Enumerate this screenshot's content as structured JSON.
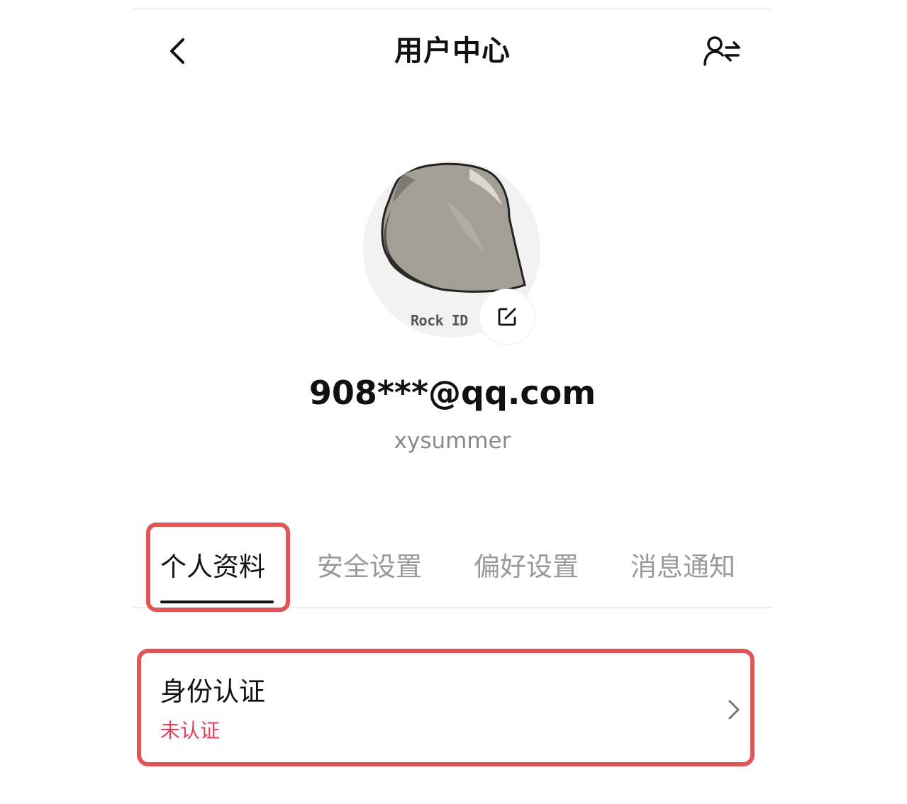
{
  "header": {
    "back_icon": "chevron-left-icon",
    "title": "用户中心",
    "switch_icon": "user-switch-icon"
  },
  "profile": {
    "avatar_caption": "Rock ID",
    "edit_icon": "edit-icon",
    "email": "908***@qq.com",
    "nickname": "xysummer"
  },
  "tabs": [
    {
      "label": "个人资料",
      "active": true
    },
    {
      "label": "安全设置",
      "active": false
    },
    {
      "label": "偏好设置",
      "active": false
    },
    {
      "label": "消息通知",
      "active": false
    }
  ],
  "identity": {
    "title": "身份认证",
    "status": "未认证",
    "chevron_icon": "chevron-right-icon"
  },
  "colors": {
    "highlight": "#e05555",
    "status_unverified": "#e0405a",
    "inactive_tab": "#999999",
    "secondary_text": "#8a8a8a"
  }
}
